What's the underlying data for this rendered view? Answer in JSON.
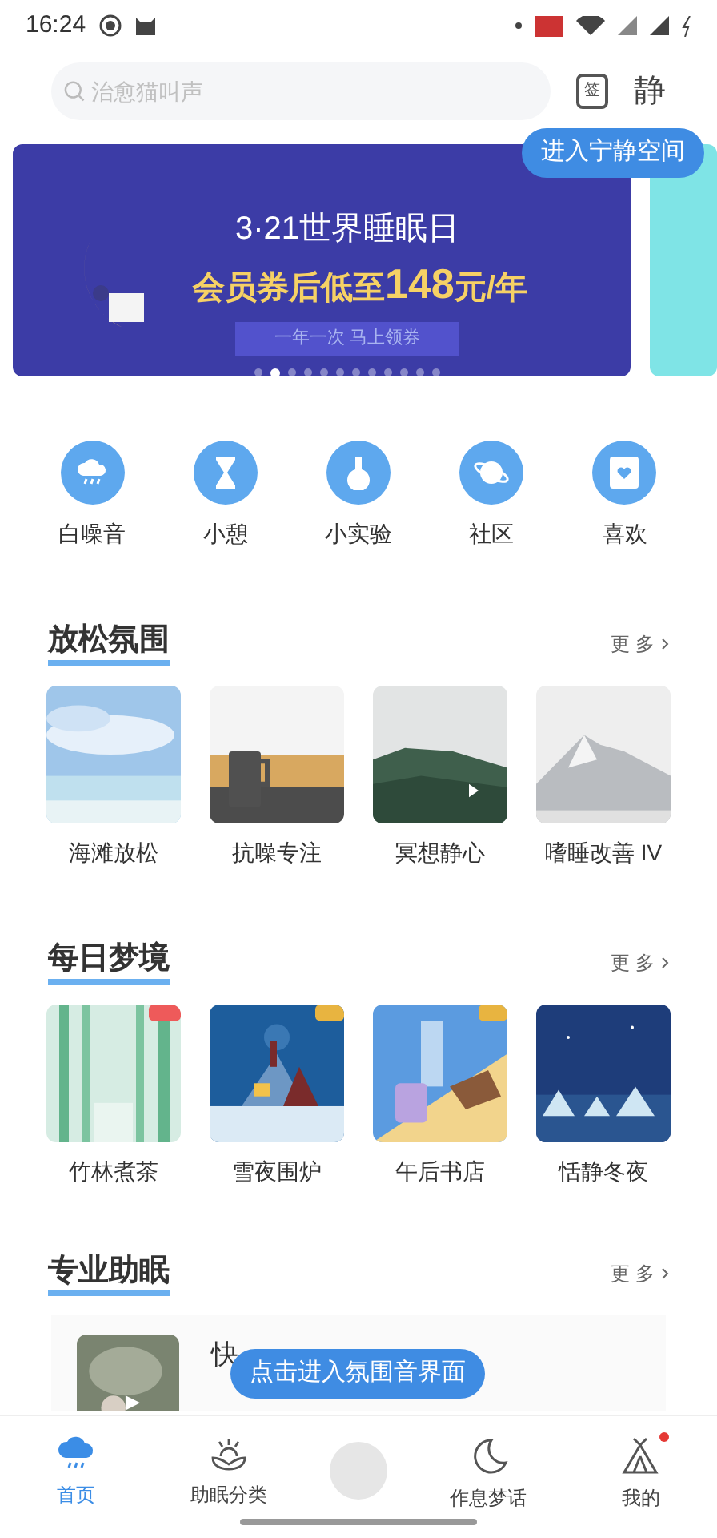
{
  "status_bar": {
    "time": "16:24"
  },
  "search": {
    "placeholder": "治愈猫叫声"
  },
  "header_actions": [
    {
      "kind": "signin",
      "label": "签"
    },
    {
      "kind": "quiet",
      "label": "静"
    }
  ],
  "quiet_tooltip": "进入宁静空间",
  "banner": {
    "title": "3·21世界睡眠日",
    "offer_prefix": "会员券后低至",
    "offer_amount": "148",
    "offer_suffix": "元/年",
    "button": "一年一次 马上领券",
    "dots": [
      {
        "selected": false
      },
      {
        "selected": true
      },
      {
        "selected": false
      },
      {
        "selected": false
      },
      {
        "selected": false
      },
      {
        "selected": false
      },
      {
        "selected": false
      },
      {
        "selected": false
      },
      {
        "selected": false
      },
      {
        "selected": false
      },
      {
        "selected": false
      },
      {
        "selected": false
      }
    ]
  },
  "shortcuts": [
    {
      "kind": "cloud",
      "label": "白噪音"
    },
    {
      "kind": "hourglass",
      "label": "小憩"
    },
    {
      "kind": "flask",
      "label": "小实验"
    },
    {
      "kind": "planet",
      "label": "社区"
    },
    {
      "kind": "heart",
      "label": "喜欢"
    }
  ],
  "sections": [
    {
      "title": "放松氛围",
      "more": "更 多",
      "items": [
        {
          "kind": "sky",
          "label": "海滩放松"
        },
        {
          "kind": "cup",
          "label": "抗噪专注"
        },
        {
          "kind": "forest",
          "label": "冥想静心"
        },
        {
          "kind": "mountain",
          "label": "嗜睡改善 IV"
        }
      ]
    },
    {
      "title": "每日梦境",
      "more": "更 多",
      "items": [
        {
          "kind": "bamboo",
          "label": "竹林煮茶"
        },
        {
          "kind": "cabin",
          "label": "雪夜围炉"
        },
        {
          "kind": "bookstore",
          "label": "午后书店"
        },
        {
          "kind": "night",
          "label": "恬静冬夜"
        }
      ]
    },
    {
      "title": "专业助眠",
      "more": "更 多"
    }
  ],
  "pro_card": {
    "title": "快"
  },
  "ambient_tooltip": "点击进入氛围音界面",
  "nav": [
    {
      "kind": "home",
      "label": "首页",
      "selected": true
    },
    {
      "kind": "lotus",
      "label": "助眠分类",
      "selected": false
    },
    {
      "kind": "player",
      "selected": false
    },
    {
      "kind": "moon",
      "label": "作息梦话",
      "selected": false
    },
    {
      "kind": "tent",
      "label": "我的",
      "selected": false,
      "dot": true
    }
  ]
}
